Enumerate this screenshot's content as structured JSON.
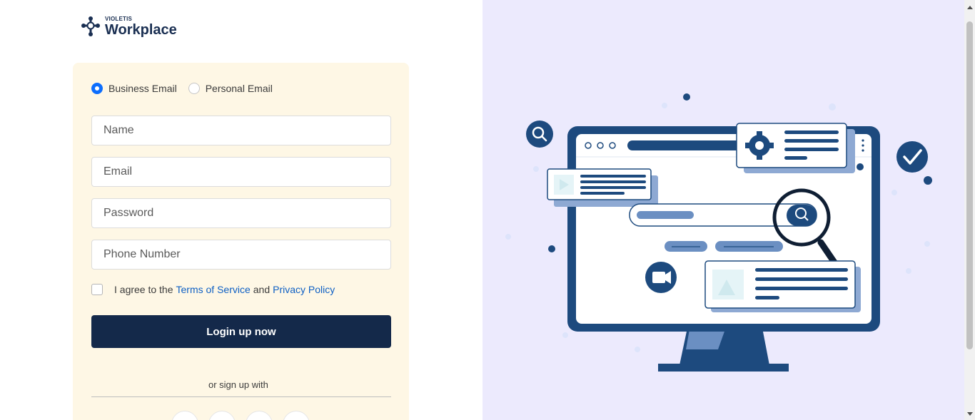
{
  "brand": {
    "tagline": "VIOLETIS",
    "name": "Workplace"
  },
  "form": {
    "email_types": [
      {
        "label": "Business Email",
        "selected": true
      },
      {
        "label": "Personal Email",
        "selected": false
      }
    ],
    "name_placeholder": "Name",
    "email_placeholder": "Email",
    "password_placeholder": "Password",
    "phone_placeholder": "Phone Number",
    "agree_prefix": "I agree to the",
    "terms_label": "Terms of Service",
    "agree_and": "and",
    "privacy_label": "Privacy Policy",
    "submit_label": "Login up now",
    "or_signup": "or sign up with"
  },
  "social_icons": [
    "google-icon",
    "twitter-icon",
    "github-icon",
    "linkedin-icon"
  ],
  "colors": {
    "primary": "#14294a",
    "accent": "#0d6efd",
    "card_bg": "#fef7e5",
    "illustration_bg": "#eceafd",
    "illustration_blue": "#1d4a7e"
  }
}
